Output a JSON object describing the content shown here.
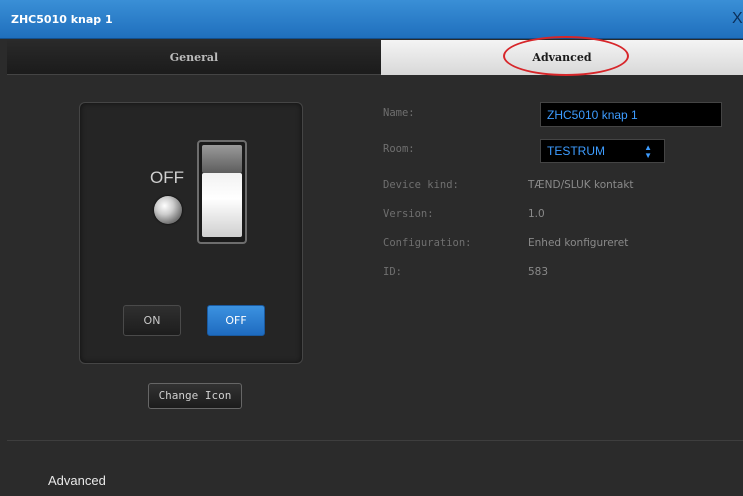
{
  "window": {
    "title": "ZHC5010 knap 1",
    "close_label": "X"
  },
  "tabs": [
    {
      "label": "General",
      "active": false
    },
    {
      "label": "Advanced",
      "active": true
    }
  ],
  "device_icon": {
    "state_label": "OFF",
    "on_button_label": "ON",
    "off_button_label": "OFF",
    "change_icon_label": "Change Icon"
  },
  "properties": {
    "name_label": "Name:",
    "name_value": "ZHC5010 knap 1",
    "room_label": "Room:",
    "room_value": "TESTRUM",
    "device_kind_label": "Device kind:",
    "device_kind_value": "TÆND/SLUK kontakt",
    "version_label": "Version:",
    "version_value": "1.0",
    "configuration_label": "Configuration:",
    "configuration_value": "Enhed konfigureret",
    "id_label": "ID:",
    "id_value": "583"
  },
  "footer": {
    "section_label": "Advanced"
  },
  "colors": {
    "accent_blue": "#1e6bc0",
    "value_blue": "#3d9cff",
    "annotation_red": "#d7262a"
  }
}
